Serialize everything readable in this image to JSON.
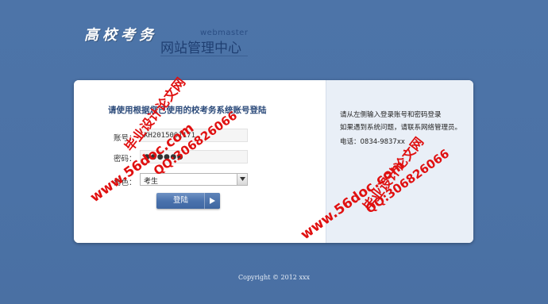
{
  "brand": {
    "calligraphy": "高校考务",
    "webmaster": "webmaster",
    "center_title": "网站管理中心"
  },
  "login": {
    "title": "请使用根据您已使用的校考务系统账号登陆",
    "account_label": "账号：",
    "account_value": "XH2015001171",
    "password_label": "密码：",
    "password_value": "●●●●●●",
    "role_label": "角色：",
    "role_value": "考生",
    "submit_label": "登陆",
    "submit_arrow_icon": "play-arrow-icon"
  },
  "info": {
    "line1": "请从左侧输入登录账号和密码登录",
    "line2": "如果遇到系统问题，请联系网络管理员。",
    "line3": "电话：0834-9837xx"
  },
  "footer": {
    "copyright": "Copyright © 2012 xxx"
  },
  "watermarks": {
    "site": "www.56doc.com",
    "qq": "QQ:306826066",
    "label": "毕业设计论文网"
  },
  "colors": {
    "background": "#4b72a6",
    "watermark": "#e01010",
    "panel_right": "#e9eff7"
  }
}
